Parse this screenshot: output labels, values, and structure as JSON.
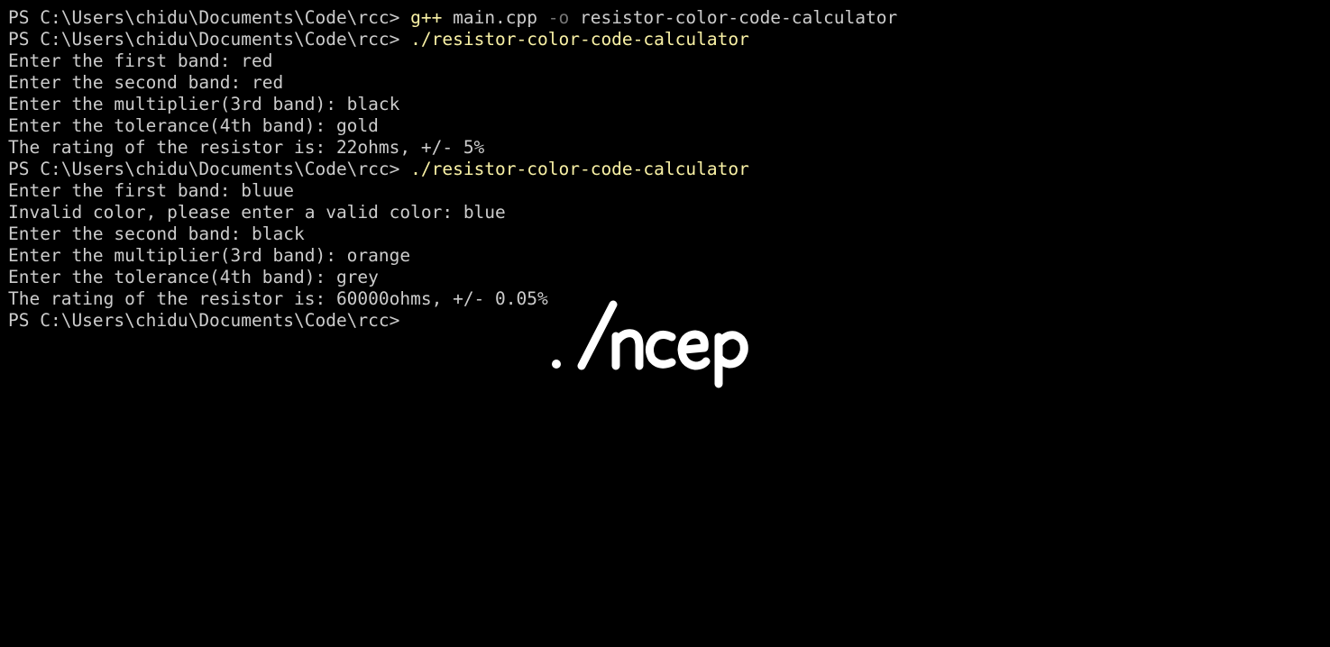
{
  "terminal": {
    "lines": [
      {
        "type": "prompt-cmd",
        "prompt": "PS C:\\Users\\chidu\\Documents\\Code\\rcc> ",
        "cmd": "g++",
        "arg1": " main.cpp ",
        "flag": "-o",
        "arg2": " resistor-color-code-calculator"
      },
      {
        "type": "prompt-run",
        "prompt": "PS C:\\Users\\chidu\\Documents\\Code\\rcc> ",
        "cmd": "./resistor-color-code-calculator"
      },
      {
        "type": "output",
        "text": "Enter the first band: red"
      },
      {
        "type": "output",
        "text": "Enter the second band: red"
      },
      {
        "type": "output",
        "text": "Enter the multiplier(3rd band): black"
      },
      {
        "type": "output",
        "text": "Enter the tolerance(4th band): gold"
      },
      {
        "type": "output",
        "text": "The rating of the resistor is: 22ohms, +/- 5%"
      },
      {
        "type": "prompt-run",
        "prompt": "PS C:\\Users\\chidu\\Documents\\Code\\rcc> ",
        "cmd": "./resistor-color-code-calculator"
      },
      {
        "type": "output",
        "text": "Enter the first band: bluue"
      },
      {
        "type": "output",
        "text": "Invalid color, please enter a valid color: blue"
      },
      {
        "type": "output",
        "text": "Enter the second band: black"
      },
      {
        "type": "output",
        "text": "Enter the multiplier(3rd band): orange"
      },
      {
        "type": "output",
        "text": "Enter the tolerance(4th band): grey"
      },
      {
        "type": "output",
        "text": "The rating of the resistor is: 60000ohms, +/- 0.05%"
      },
      {
        "type": "prompt",
        "prompt": "PS C:\\Users\\chidu\\Documents\\Code\\rcc> "
      }
    ]
  },
  "watermark": {
    "text": "./ncep"
  },
  "colors": {
    "background": "#000000",
    "text": "#cccccc",
    "command": "#f9f1a5",
    "flag": "#767676",
    "watermark": "#ffffff"
  }
}
